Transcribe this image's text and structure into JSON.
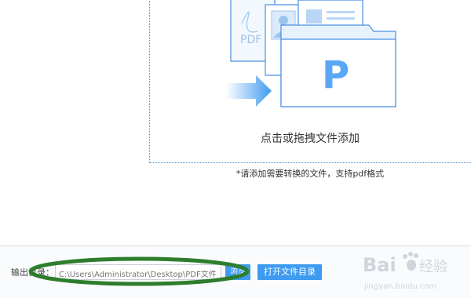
{
  "drop_zone": {
    "label": "点击或拖拽文件添加",
    "hint": "*请添加需要转换的文件，支持pdf格式",
    "illustration": {
      "pdf_doc_text": "PDF",
      "folder_logo": "P",
      "arrow_icon": "right-arrow-icon"
    }
  },
  "footer": {
    "output_label": "输出目录：",
    "output_path": "C:\\Users\\Administrator\\Desktop\\PDF文件",
    "browse_label": "浏览",
    "open_folder_label": "打开文件目录"
  },
  "watermark": {
    "brand": "Bai",
    "brand_suffix": "经验",
    "url": "jingyan.baidu.com"
  },
  "colors": {
    "accent": "#3e9bf0",
    "dotted_border": "#4a90d9",
    "annotation": "#2e7d2e"
  }
}
